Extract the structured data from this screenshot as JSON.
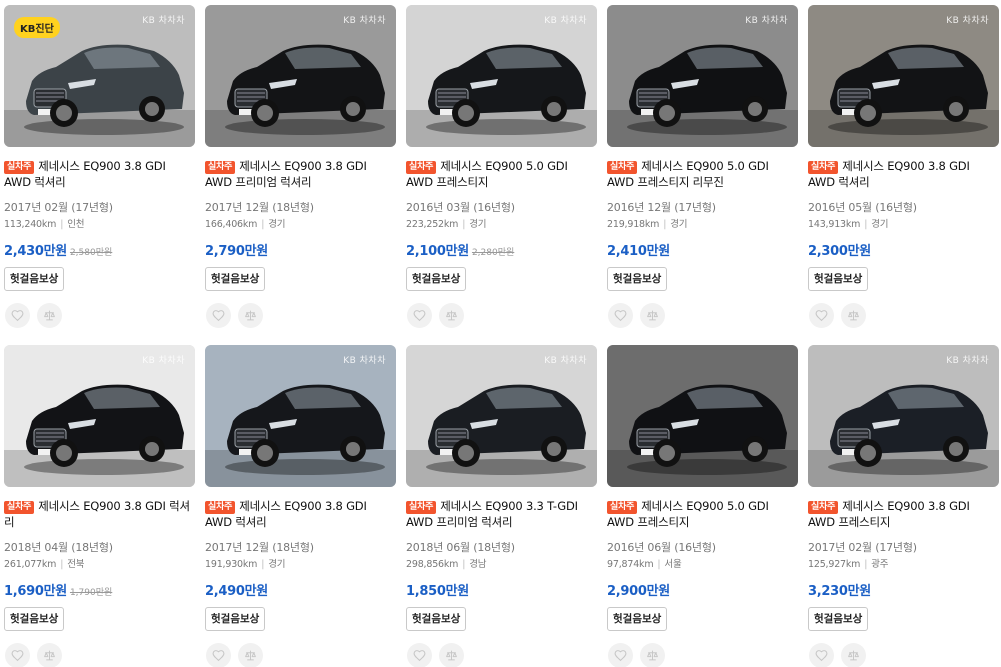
{
  "common": {
    "owner_tag": "실차주",
    "compensation_label": "헛걸음보상",
    "heart_icon": "heart-icon",
    "compare_icon": "scale-icon"
  },
  "cars": [
    {
      "title": "제네시스 EQ900 3.8 GDI AWD 럭셔리",
      "year": "2017년 02월 (17년형)",
      "mileage": "113,240km",
      "region": "인천",
      "price": "2,430만원",
      "original_price": "2,580만원",
      "watermark": "KB 차차차",
      "badge": "KB진단",
      "plate": "",
      "bg": "#bdbdbd",
      "carColor": "#3c4348"
    },
    {
      "title": "제네시스 EQ900 3.8 GDI AWD 프리미엄 럭셔리",
      "year": "2017년 12월 (18년형)",
      "mileage": "166,406km",
      "region": "경기",
      "price": "2,790만원",
      "original_price": "",
      "watermark": "KB 차차차",
      "badge": "",
      "plate": "",
      "bg": "#9a9a9a",
      "carColor": "#131416"
    },
    {
      "title": "제네시스 EQ900 5.0 GDI AWD 프레스티지",
      "year": "2016년 03월 (16년형)",
      "mileage": "223,252km",
      "region": "경기",
      "price": "2,100만원",
      "original_price": "2,280만원",
      "watermark": "KB 차차차",
      "badge": "",
      "plate": "",
      "bg": "#d4d4d4",
      "carColor": "#15171a"
    },
    {
      "title": "제네시스 EQ900 5.0 GDI AWD 프레스티지 리무진",
      "year": "2016년 12월 (17년형)",
      "mileage": "219,918km",
      "region": "경기",
      "price": "2,410만원",
      "original_price": "",
      "watermark": "KB 차차차",
      "badge": "",
      "plate": "",
      "bg": "#8c8c8c",
      "carColor": "#101113"
    },
    {
      "title": "제네시스 EQ900 3.8 GDI AWD 럭셔리",
      "year": "2016년 05월 (16년형)",
      "mileage": "143,913km",
      "region": "경기",
      "price": "2,300만원",
      "original_price": "",
      "watermark": "KB 차차차",
      "badge": "",
      "plate": "",
      "bg": "#8e8a83",
      "carColor": "#121315"
    },
    {
      "title": "제네시스 EQ900 3.8 GDI 럭셔리",
      "year": "2018년 04월 (18년형)",
      "mileage": "261,077km",
      "region": "전북",
      "price": "1,690만원",
      "original_price": "1,790만원",
      "watermark": "KB 차차차",
      "badge": "",
      "plate": "",
      "bg": "#e9e9e9",
      "carColor": "#121316"
    },
    {
      "title": "제네시스 EQ900 3.8 GDI AWD 럭셔리",
      "year": "2017년 12월 (18년형)",
      "mileage": "191,930km",
      "region": "경기",
      "price": "2,490만원",
      "original_price": "",
      "watermark": "KB 차차차",
      "badge": "",
      "plate": "",
      "bg": "#a7b3bf",
      "carColor": "#15171b"
    },
    {
      "title": "제네시스 EQ900 3.3 T-GDI AWD 프리미엄 럭셔리",
      "year": "2018년 06월 (18년형)",
      "mileage": "298,856km",
      "region": "경남",
      "price": "1,850만원",
      "original_price": "",
      "watermark": "KB 차차차",
      "badge": "",
      "plate": "",
      "bg": "#d6d6d6",
      "carColor": "#1a1d22"
    },
    {
      "title": "제네시스 EQ900 5.0 GDI AWD 프레스티지",
      "year": "2016년 06월 (16년형)",
      "mileage": "97,874km",
      "region": "서울",
      "price": "2,900만원",
      "original_price": "",
      "watermark": "",
      "badge": "",
      "plate": "2Q허 6880",
      "bg": "#6d6d6d",
      "carColor": "#101114"
    },
    {
      "title": "제네시스 EQ900 3.8 GDI AWD 프레스티지",
      "year": "2017년 02월 (17년형)",
      "mileage": "125,927km",
      "region": "광주",
      "price": "3,230만원",
      "original_price": "",
      "watermark": "KB 차차차",
      "badge": "",
      "plate": "",
      "bg": "#bdbdbd",
      "carColor": "#1b1f26"
    }
  ]
}
